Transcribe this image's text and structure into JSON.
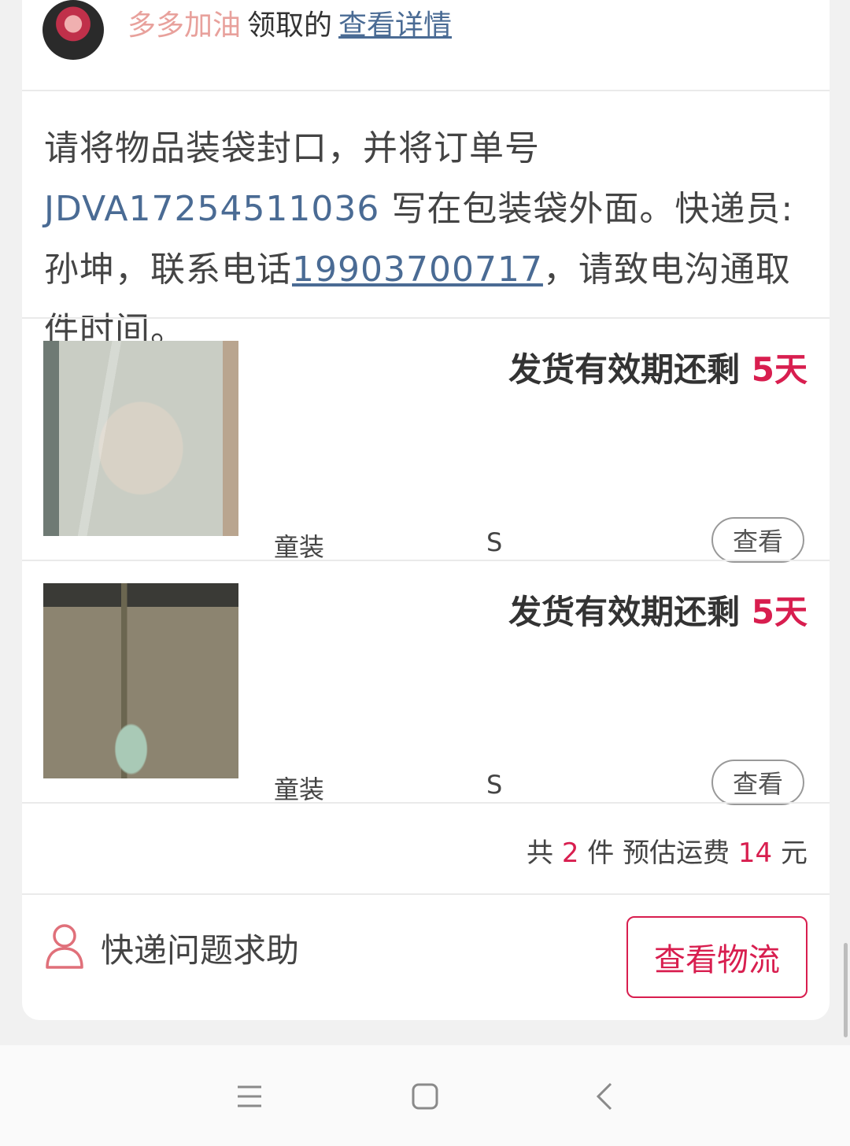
{
  "claim": {
    "user_name": "多多加油",
    "verb": "领取的",
    "details_link": "查看详情"
  },
  "notice": {
    "part1": "请将物品装袋封口，并将订单号",
    "order_no": "JDVA17254511036",
    "part2": "写在包装袋外面。快递员:孙坤，联系电话",
    "phone": "19903700717",
    "part3": "，请致电沟通取件时间。"
  },
  "items": [
    {
      "validity_label": "发货有效期还剩",
      "validity_days": "5天",
      "category": "童装",
      "size": "S",
      "view_label": "查看"
    },
    {
      "validity_label": "发货有效期还剩",
      "validity_days": "5天",
      "category": "童装",
      "size": "S",
      "view_label": "查看"
    }
  ],
  "summary": {
    "prefix": "共",
    "count": "2",
    "count_unit": "件 预估运费",
    "fee": "14",
    "fee_unit": "元"
  },
  "actions": {
    "help_label": "快递问题求助",
    "logistics_label": "查看物流"
  },
  "colors": {
    "accent": "#d81e4f",
    "link": "#4a6b94",
    "name": "#e8a19c"
  }
}
